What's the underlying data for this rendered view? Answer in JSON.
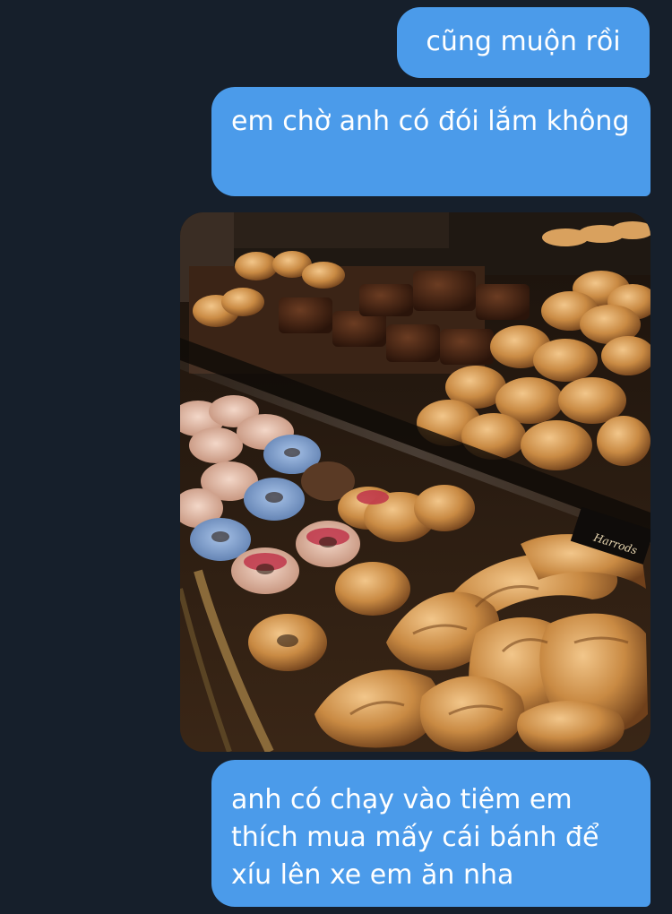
{
  "messages": [
    {
      "id": "msg-1",
      "direction": "outgoing",
      "type": "text",
      "text": "cũng muộn rồi"
    },
    {
      "id": "msg-2",
      "direction": "outgoing",
      "type": "text",
      "text": "em chờ anh có đói lắm không"
    },
    {
      "id": "msg-3",
      "direction": "outgoing",
      "type": "image",
      "alt": ""
    },
    {
      "id": "msg-4",
      "direction": "outgoing",
      "type": "text",
      "text": "anh có chạy vào tiệm em thích mua mấy cái bánh để xíu lên xe em ăn nha"
    }
  ],
  "photo": {
    "signage": "Harrods"
  },
  "colors": {
    "background": "#161f2b",
    "bubble": "#4b9bea",
    "bubble_text": "#ffffff"
  }
}
